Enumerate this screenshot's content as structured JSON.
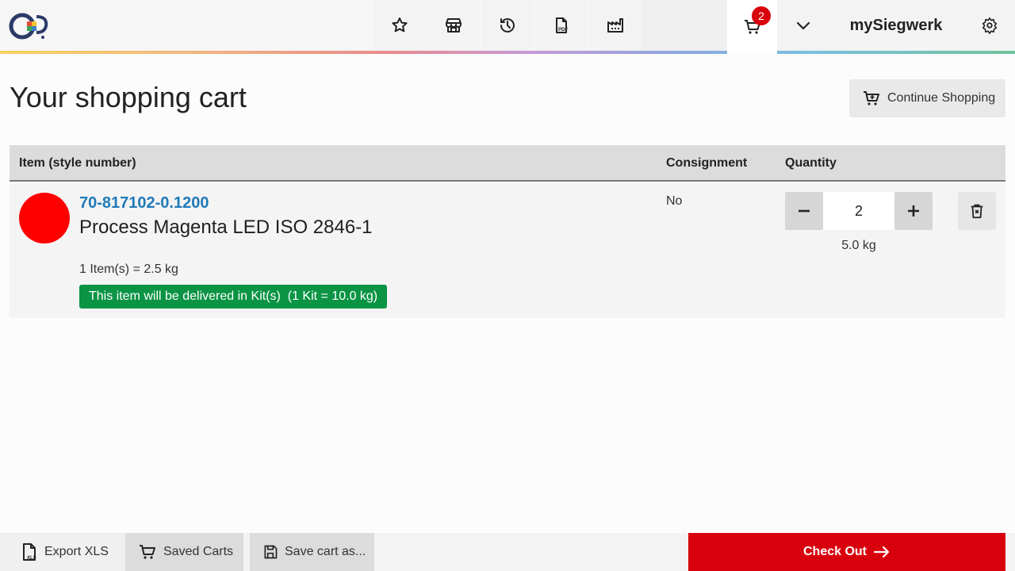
{
  "header": {
    "cart_count": "2",
    "brand": "mySiegwerk"
  },
  "page": {
    "title": "Your shopping cart",
    "continue_label": "Continue Shopping"
  },
  "table": {
    "columns": [
      "Item (style number)",
      "Consignment",
      "Quantity"
    ],
    "rows": [
      {
        "style_number": "70-817102-0.1200",
        "name": "Process Magenta LED ISO 2846-1",
        "unit_info": "1 Item(s) = 2.5 kg",
        "kit_info": "This item will be delivered in Kit(s)  (1 Kit = 10.0 kg)",
        "consignment": "No",
        "quantity": "2",
        "weight": "5.0 kg",
        "color": "#ff0000"
      }
    ]
  },
  "footer": {
    "export_label": "Export XLS",
    "saved_label": "Saved Carts",
    "save_as_label": "Save cart as...",
    "checkout_label": "Check Out"
  },
  "icons": [
    "star-icon",
    "store-icon",
    "history-icon",
    "pdf-icon",
    "factory-icon",
    "cart-icon",
    "chevron-down-icon",
    "gear-icon",
    "cart-plus-icon",
    "minus-icon",
    "plus-icon",
    "delete-icon",
    "xls-icon",
    "save-icon",
    "arrow-right-icon"
  ],
  "colors": {
    "accent_red": "#d9000d",
    "link_blue": "#1f7ab8",
    "kit_green": "#0a9444"
  }
}
